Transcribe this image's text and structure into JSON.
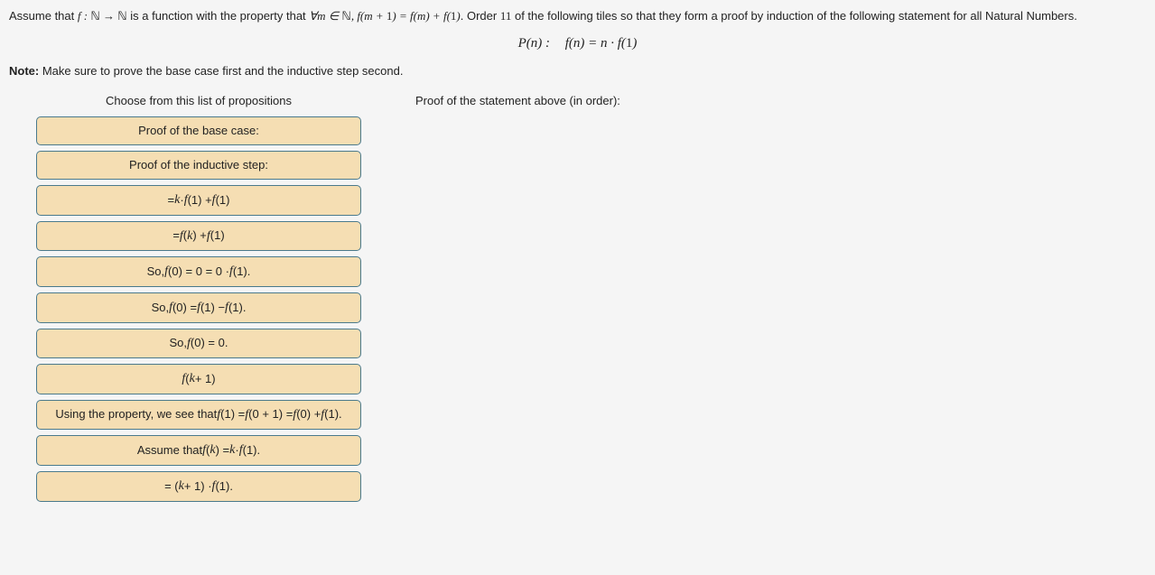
{
  "problem": {
    "intro_pre": "Assume that ",
    "func_def": "f : ℕ → ℕ",
    "intro_mid": " is a function with the property that ",
    "property": "∀m ∈ ℕ, f(m + 1) = f(m) + f(1)",
    "intro_post1": ". Order ",
    "order_count": "11",
    "intro_post2": " of the following tiles so that they form a proof by induction of the following statement for all Natural Numbers."
  },
  "statement": {
    "label": "P(n) :",
    "body": "f(n) = n · f(1)"
  },
  "note_label": "Note:",
  "note_text": " Make sure to prove the base case first and the inductive step second.",
  "columns": {
    "left_header": "Choose from this list of propositions",
    "right_header": "Proof of the statement above (in order):"
  },
  "tiles": [
    {
      "id": "tile-base-case",
      "html": "Proof of the base case:"
    },
    {
      "id": "tile-inductive-step",
      "html": "Proof of the inductive step:"
    },
    {
      "id": "tile-kf1-plus-f1",
      "html": "= <span class='math'>k</span> · <span class='math'>f</span>(1) + <span class='math'>f</span>(1)"
    },
    {
      "id": "tile-fk-plus-f1",
      "html": "= <span class='math'>f</span>(<span class='math'>k</span>) + <span class='math'>f</span>(1)"
    },
    {
      "id": "tile-f0-eq-0f1",
      "html": "So, <span class='math'>f</span>(0) = 0 = 0 · <span class='math'>f</span>(1)."
    },
    {
      "id": "tile-f0-eq-diff",
      "html": "So, <span class='math'>f</span>(0) = <span class='math'>f</span>(1) − <span class='math'>f</span>(1)."
    },
    {
      "id": "tile-f0-eq-0",
      "html": "So, <span class='math'>f</span>(0) = 0."
    },
    {
      "id": "tile-fk-plus-1",
      "html": "<span class='math'>f</span>(<span class='math'>k</span> + 1)"
    },
    {
      "id": "tile-using-property",
      "html": "Using the property, we see that<br><span class='math'>f</span>(1) = <span class='math'>f</span>(0 + 1) = <span class='math'>f</span>(0) + <span class='math'>f</span>(1)."
    },
    {
      "id": "tile-assume-fk",
      "html": "Assume that <span class='math'>f</span>(<span class='math'>k</span>) = <span class='math'>k</span> · <span class='math'>f</span>(1)."
    },
    {
      "id": "tile-kplus1-f1",
      "html": "= (<span class='math'>k</span> + 1) · <span class='math'>f</span>(1)."
    }
  ]
}
